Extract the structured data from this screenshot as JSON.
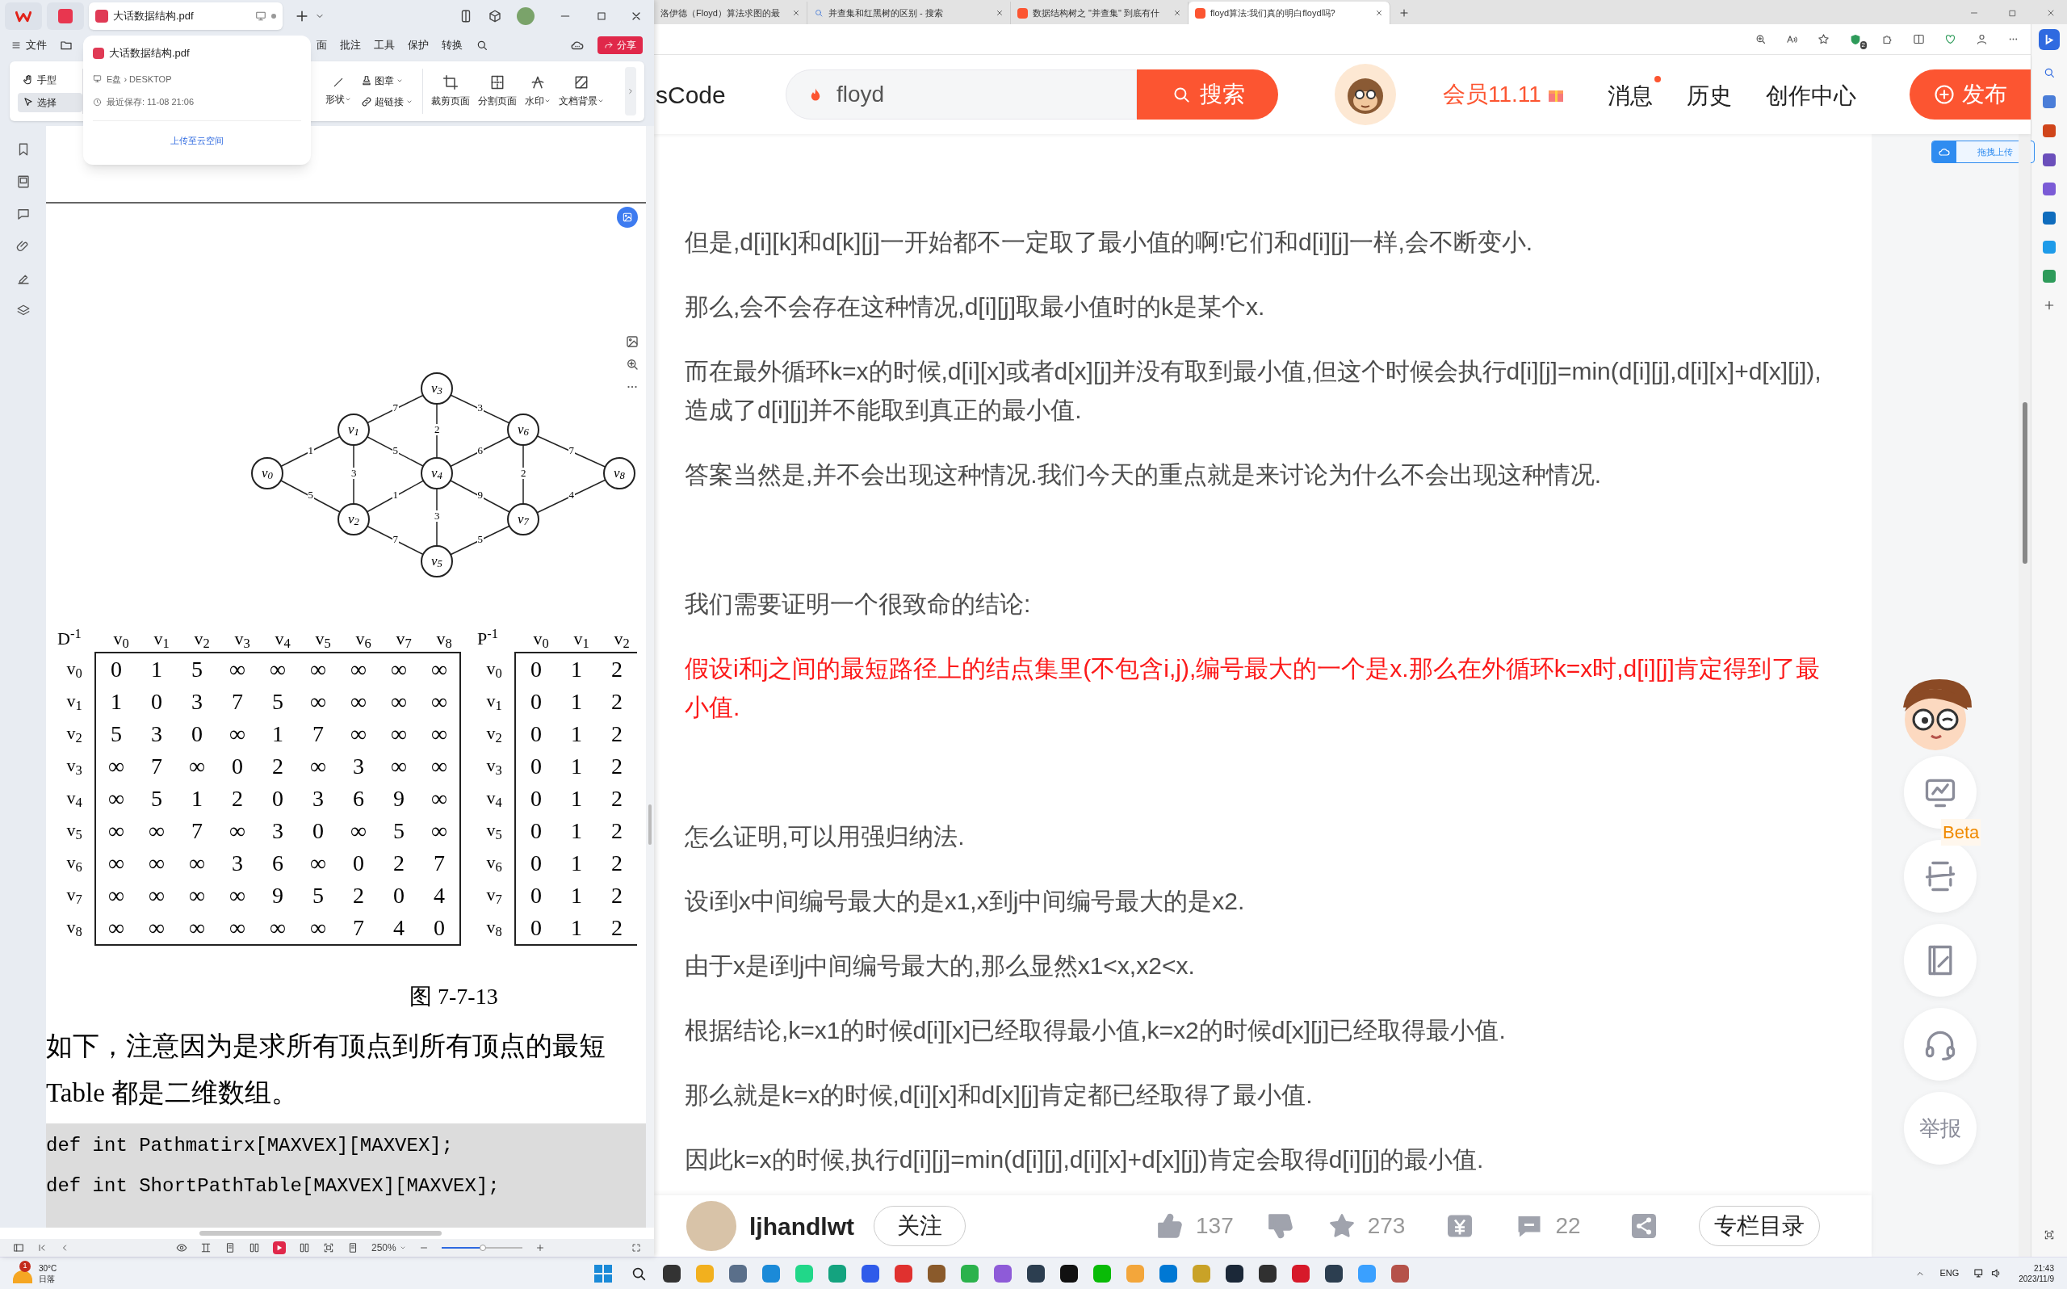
{
  "wps": {
    "tab_title": "大话数据结构.pdf",
    "menu": [
      "文件",
      "面",
      "批注",
      "工具",
      "保护",
      "转换"
    ],
    "share_button": "分享",
    "tools": [
      {
        "label": "手型",
        "selected": false
      },
      {
        "label": "选择",
        "selected": true
      }
    ],
    "insert_tools": [
      "形状",
      "图章",
      "超链接"
    ],
    "page_tools": [
      "裁剪页面",
      "分割页面",
      "水印",
      "文档背景"
    ],
    "popup": {
      "title": "大话数据结构.pdf",
      "location": "E盘 › DESKTOP",
      "saved": "最近保存: 11-08 21:06",
      "upload_link": "上传至云空间"
    },
    "page": {
      "graph": {
        "nodes": [
          "v$_{0}$",
          "v$_{1}$",
          "v$_{2}$",
          "v$_{3}$",
          "v$_{4}$",
          "v$_{5}$",
          "v$_{6}$",
          "v$_{7}$",
          "v$_{8}$"
        ],
        "edges": [
          {
            "weight": "1"
          },
          {
            "weight": "5"
          },
          {
            "weight": "3"
          },
          {
            "weight": "7"
          },
          {
            "weight": "5"
          },
          {
            "weight": "1"
          },
          {
            "weight": "7"
          },
          {
            "weight": "2"
          },
          {
            "weight": "3"
          },
          {
            "weight": "3"
          },
          {
            "weight": "6"
          },
          {
            "weight": "9"
          },
          {
            "weight": "5"
          },
          {
            "weight": "2"
          },
          {
            "weight": "7"
          },
          {
            "weight": "4"
          }
        ]
      },
      "matrix_d": {
        "label": "D$^{-1}$",
        "columns": [
          "v$_{0}$",
          "v$_{1}$",
          "v$_{2}$",
          "v$_{3}$",
          "v$_{4}$",
          "v$_{5}$",
          "v$_{6}$",
          "v$_{7}$",
          "v$_{8}$"
        ],
        "rows": [
          {
            "label": "v$_{0}$",
            "cells": [
              "0",
              "1",
              "5",
              "∞",
              "∞",
              "∞",
              "∞",
              "∞",
              "∞"
            ]
          },
          {
            "label": "v$_{1}$",
            "cells": [
              "1",
              "0",
              "3",
              "7",
              "5",
              "∞",
              "∞",
              "∞",
              "∞"
            ]
          },
          {
            "label": "v$_{2}$",
            "cells": [
              "5",
              "3",
              "0",
              "∞",
              "1",
              "7",
              "∞",
              "∞",
              "∞"
            ]
          },
          {
            "label": "v$_{3}$",
            "cells": [
              "∞",
              "7",
              "∞",
              "0",
              "2",
              "∞",
              "3",
              "∞",
              "∞"
            ]
          },
          {
            "label": "v$_{4}$",
            "cells": [
              "∞",
              "5",
              "1",
              "2",
              "0",
              "3",
              "6",
              "9",
              "∞"
            ]
          },
          {
            "label": "v$_{5}$",
            "cells": [
              "∞",
              "∞",
              "7",
              "∞",
              "3",
              "0",
              "∞",
              "5",
              "∞"
            ]
          },
          {
            "label": "v$_{6}$",
            "cells": [
              "∞",
              "∞",
              "∞",
              "3",
              "6",
              "∞",
              "0",
              "2",
              "7"
            ]
          },
          {
            "label": "v$_{7}$",
            "cells": [
              "∞",
              "∞",
              "∞",
              "∞",
              "9",
              "5",
              "2",
              "0",
              "4"
            ]
          },
          {
            "label": "v$_{8}$",
            "cells": [
              "∞",
              "∞",
              "∞",
              "∞",
              "∞",
              "∞",
              "7",
              "4",
              "0"
            ]
          }
        ]
      },
      "matrix_p": {
        "label": "P$^{-1}$",
        "columns": [
          "v$_{0}$",
          "v$_{1}$",
          "v$_{2}$"
        ],
        "rows": [
          {
            "label": "v$_{0}$",
            "cells": [
              "0",
              "1",
              "2"
            ]
          },
          {
            "label": "v$_{1}$",
            "cells": [
              "0",
              "1",
              "2"
            ]
          },
          {
            "label": "v$_{2}$",
            "cells": [
              "0",
              "1",
              "2"
            ]
          },
          {
            "label": "v$_{3}$",
            "cells": [
              "0",
              "1",
              "2"
            ]
          },
          {
            "label": "v$_{4}$",
            "cells": [
              "0",
              "1",
              "2"
            ]
          },
          {
            "label": "v$_{5}$",
            "cells": [
              "0",
              "1",
              "2"
            ]
          },
          {
            "label": "v$_{6}$",
            "cells": [
              "0",
              "1",
              "2"
            ]
          },
          {
            "label": "v$_{7}$",
            "cells": [
              "0",
              "1",
              "2"
            ]
          },
          {
            "label": "v$_{8}$",
            "cells": [
              "0",
              "1",
              "2"
            ]
          }
        ]
      },
      "caption": "图 7-7-13",
      "lines": [
        "如下，注意因为是求所有顶点到所有顶点的最短",
        "Table 都是二维数组。"
      ],
      "code": [
        "def int Pathmatirx[MAXVEX][MAXVEX];",
        "def int ShortPathTable[MAXVEX][MAXVEX];"
      ]
    },
    "status_bar": {
      "zoom": "250%",
      "zoom_slider": {
        "level": 0.51
      }
    }
  },
  "browser": {
    "tabs": [
      {
        "kind": "none",
        "title": "洛伊德（Floyd）算法求图的最",
        "selected": false
      },
      {
        "kind": "search",
        "title": "并查集和红黑树的区别 - 搜索",
        "selected": false
      },
      {
        "kind": "csdn",
        "title": "数据结构树之 \"并查集\" 到底有什",
        "selected": false
      },
      {
        "kind": "csdn",
        "title": "floyd算法:我们真的明白floyd吗?",
        "selected": true
      }
    ],
    "extension_badge": "2",
    "header": {
      "logo_text": "sCode",
      "search_value": "floyd",
      "search_button": "搜索",
      "vip": "会员11.11",
      "nav": [
        {
          "label": "消息",
          "badge": true
        },
        {
          "label": "历史",
          "badge": false
        },
        {
          "label": "创作中心",
          "badge": false
        }
      ],
      "publish_button": "发布"
    },
    "upload_badge": "拖拽上传",
    "article_sections": [
      {
        "paragraphs": [
          {
            "text": "但是,d[i][k]和d[k][j]一开始都不一定取了最小值的啊!它们和d[i][j]一样,会不断变小.",
            "highlighted": false
          },
          {
            "text": "那么,会不会存在这种情况,d[i][j]取最小值时的k是某个x.",
            "highlighted": false
          },
          {
            "text": "而在最外循环k=x的时候,d[i][x]或者d[x][j]并没有取到最小值,但这个时候会执行d[i][j]=min(d[i][j],d[i][x]+d[x][j]),造成了d[i][j]并不能取到真正的最小值.",
            "highlighted": false
          },
          {
            "text": "答案当然是,并不会出现这种情况.我们今天的重点就是来讨论为什么不会出现这种情况.",
            "highlighted": false
          }
        ]
      },
      {
        "paragraphs": [
          {
            "text": "我们需要证明一个很致命的结论:",
            "highlighted": false
          },
          {
            "text": "假设i和j之间的最短路径上的结点集里(不包含i,j),编号最大的一个是x.那么在外循环k=x时,d[i][j]肯定得到了最小值.",
            "highlighted": true
          }
        ]
      },
      {
        "paragraphs": [
          {
            "text": "怎么证明,可以用强归纳法.",
            "highlighted": false
          },
          {
            "text": "设i到x中间编号最大的是x1,x到j中间编号最大的是x2.",
            "highlighted": false
          },
          {
            "text": "由于x是i到j中间编号最大的,那么显然x1<x,x2<x.",
            "highlighted": false
          },
          {
            "text": "根据结论,k=x1的时候d[i][x]已经取得最小值,k=x2的时候d[x][j]已经取得最小值.",
            "highlighted": false
          },
          {
            "text": "那么就是k=x的时候,d[i][x]和d[x][j]肯定都已经取得了最小值.",
            "highlighted": false
          },
          {
            "text": "因此k=x的时候,执行d[i][j]=min(d[i][j],d[i][x]+d[x][j])肯定会取得d[i][j]的最小值.",
            "highlighted": false
          }
        ]
      }
    ],
    "side_buttons": [
      {
        "kind": "trend"
      },
      {
        "kind": "layout",
        "tag": "Beta"
      },
      {
        "kind": "edit"
      },
      {
        "kind": "headset"
      },
      {
        "kind": "text",
        "label": "举报"
      }
    ],
    "footer": {
      "author": "ljhandlwt",
      "follow_button": "关注",
      "likes": "137",
      "stars": "273",
      "comments": "22",
      "catalog_button": "专栏目录"
    }
  },
  "taskbar": {
    "weather": {
      "badge": "1",
      "temperature": "30°C",
      "condition": "日落"
    },
    "apps": [
      {
        "color": "#333333"
      },
      {
        "color": "#f2b01e"
      },
      {
        "color": "#5a6f8a"
      },
      {
        "color": "#1b8ad8"
      },
      {
        "color": "#21d789"
      },
      {
        "color": "#14a37f"
      },
      {
        "color": "#2f5bea"
      },
      {
        "color": "#e0312f"
      },
      {
        "color": "#8a5a2b"
      },
      {
        "color": "#2bb24c"
      },
      {
        "color": "#8e5bd8"
      },
      {
        "color": "#2c3e50"
      },
      {
        "color": "#111111"
      },
      {
        "color": "#09bb07"
      },
      {
        "color": "#f3a63b"
      },
      {
        "color": "#0078d4"
      },
      {
        "color": "#c9a227"
      },
      {
        "color": "#1b2838"
      },
      {
        "color": "#303030"
      },
      {
        "color": "#d7192a"
      },
      {
        "color": "#2c3e50"
      },
      {
        "color": "#3aa0ff"
      },
      {
        "color": "#b5524a"
      }
    ],
    "language": "ENG",
    "time": "21:43",
    "date": "2023/11/9"
  }
}
